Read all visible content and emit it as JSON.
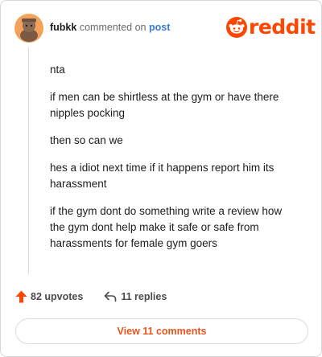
{
  "comment": {
    "username": "fubkk",
    "action_text": "commented on",
    "post_link_label": "post",
    "paragraphs": [
      "nta",
      "if men can be shirtless at the gym or have there nipples pocking",
      "then so can we",
      "hes a idiot next time if it happens report him its harassment",
      "if the gym dont do something write a review how the gym dont help make it safe or safe from harassments for female gym goers"
    ]
  },
  "brand": {
    "wordmark": "reddit",
    "icon": "reddit-alien-icon",
    "color": "#ff4500"
  },
  "actions": {
    "upvotes_label": "82 upvotes",
    "upvote_icon": "upvote-arrow-icon",
    "upvote_color": "#ff4500",
    "replies_label": "11 replies",
    "reply_icon": "reply-arrow-icon"
  },
  "footer": {
    "view_comments_label": "View 11 comments",
    "accent": "#e8541e"
  }
}
